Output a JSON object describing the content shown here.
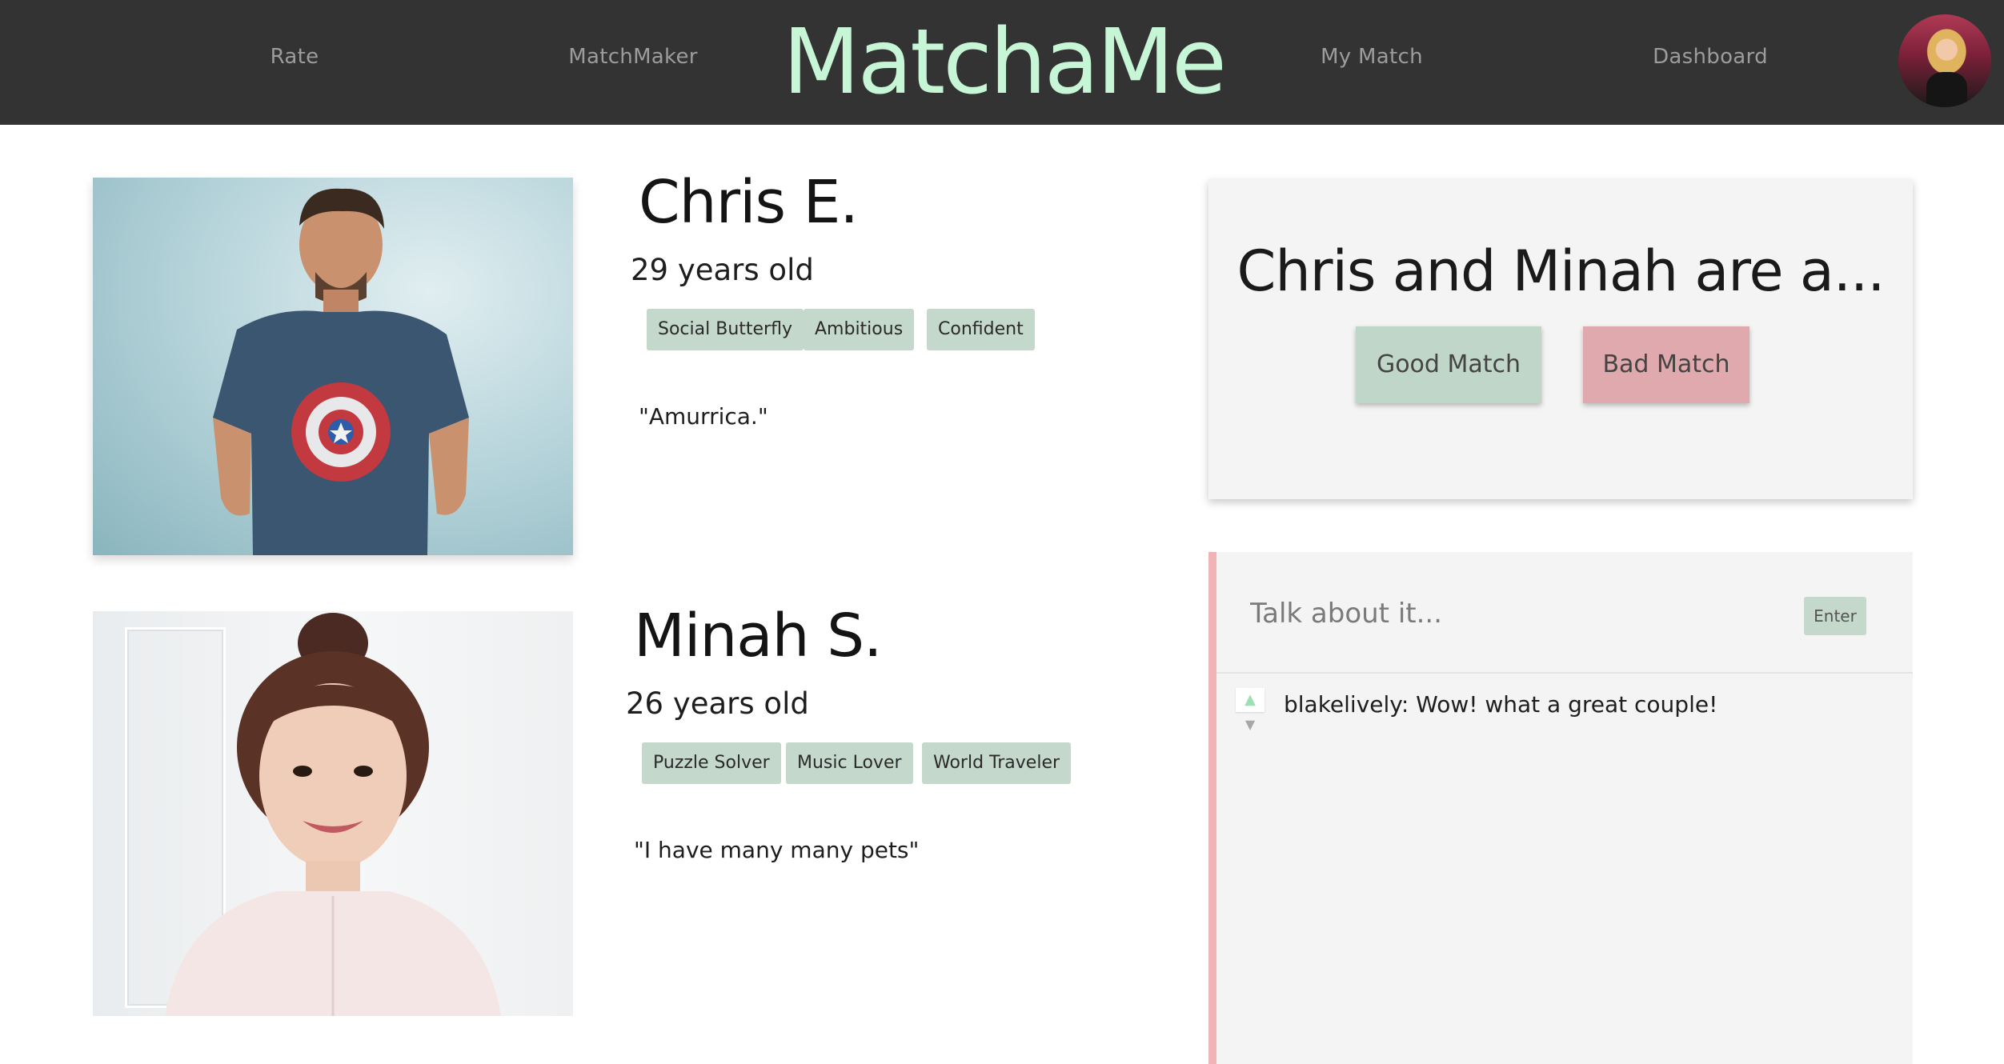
{
  "app": {
    "brand": "MatchaMe"
  },
  "nav": {
    "links": [
      "Rate",
      "MatchMaker",
      "My Match",
      "Dashboard"
    ]
  },
  "profiles": [
    {
      "name": "Chris E.",
      "age": "29 years old",
      "traits": [
        "Social Butterfly",
        "Ambitious",
        "Confident"
      ],
      "quote": "\"Amurrica.\""
    },
    {
      "name": "Minah S.",
      "age": "26 years old",
      "traits": [
        "Puzzle Solver",
        "Music Lover",
        "World Traveler"
      ],
      "quote": "\"I have many many pets\""
    }
  ],
  "verdict": {
    "heading": "Chris and Minah are a...",
    "good_label": "Good Match",
    "bad_label": "Bad Match"
  },
  "discussion": {
    "placeholder": "Talk about it...",
    "enter_label": "Enter",
    "comments": [
      {
        "text": "blakelively: Wow! what a great couple!",
        "up_icon": "triangle-up-icon",
        "down_icon": "triangle-down-icon"
      }
    ]
  },
  "colors": {
    "navbar": "#333333",
    "brand": "#c6f6d5",
    "tag": "#c4d8cc",
    "good": "#bfd6c8",
    "bad": "#e0a9ad",
    "discussion_accent": "#f0b4b6"
  }
}
